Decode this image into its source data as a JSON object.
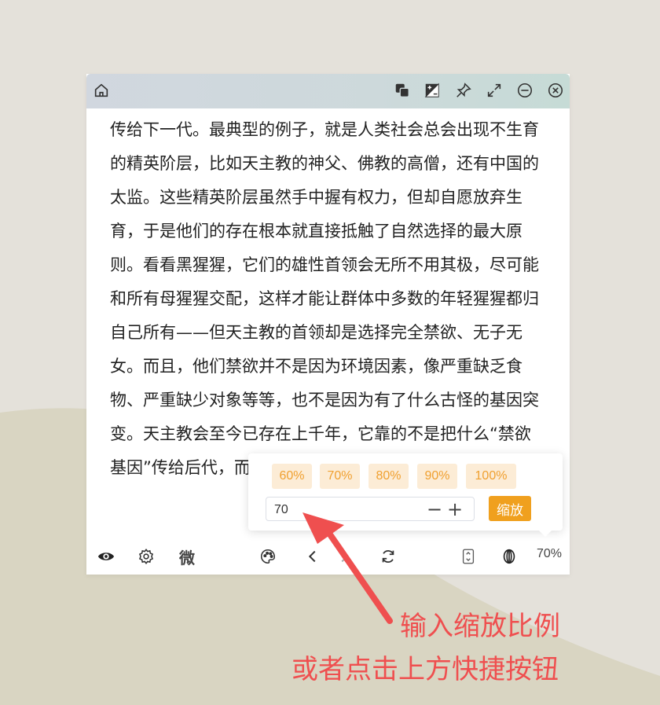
{
  "colors": {
    "background": "#e4e1da",
    "wave": "#d9d5c2",
    "accent": "#f0a01e",
    "preset_bg": "#fcecd6",
    "preset_text": "#f0a030",
    "annotation": "#ef4f4f"
  },
  "titlebar": {
    "left_icon": "home-icon",
    "right_icons": [
      "copy-icon",
      "contrast-icon",
      "pin-icon",
      "expand-icon",
      "minimize-icon",
      "close-icon"
    ]
  },
  "content": {
    "text": "传给下一代。最典型的例子，就是人类社会总会出现不生育的精英阶层，比如天主教的神父、佛教的高僧，还有中国的太监。这些精英阶层虽然手中握有权力，但却自愿放弃生育，于是他们的存在根本就直接抵触了自然选择的最大原则。看看黑猩猩，它们的雄性首领会无所不用其极，尽可能和所有母猩猩交配，这样才能让群体中多数的年轻猩猩都归自己所有——但天主教的首领却是选择完全禁欲、无子无女。而且，他们禁欲并不是因为环境因素，像严重缺乏食物、严重缺少对象等等，也不是因为有了什么古怪的基因突变。天主教会至今已存在上千年，它靠的不是把什么“禁欲基因”传给后代，而是靠着《圣经·新约》和天主教的教义。“"
  },
  "bottombar": {
    "icons": [
      "eye-icon",
      "gear-icon",
      "palette-icon",
      "chevron-left-icon",
      "chevron-right-icon",
      "refresh-icon",
      "scroll-icon",
      "zoom-icon"
    ],
    "wei_label": "微",
    "zoom_level": "70%"
  },
  "zoom_popover": {
    "presets": [
      "60%",
      "70%",
      "80%",
      "90%",
      "100%"
    ],
    "input_value": "70",
    "minus": "−",
    "plus": "+",
    "apply_label": "缩放"
  },
  "annotation": {
    "line1": "输入缩放比例",
    "line2": "或者点击上方快捷按钮"
  }
}
